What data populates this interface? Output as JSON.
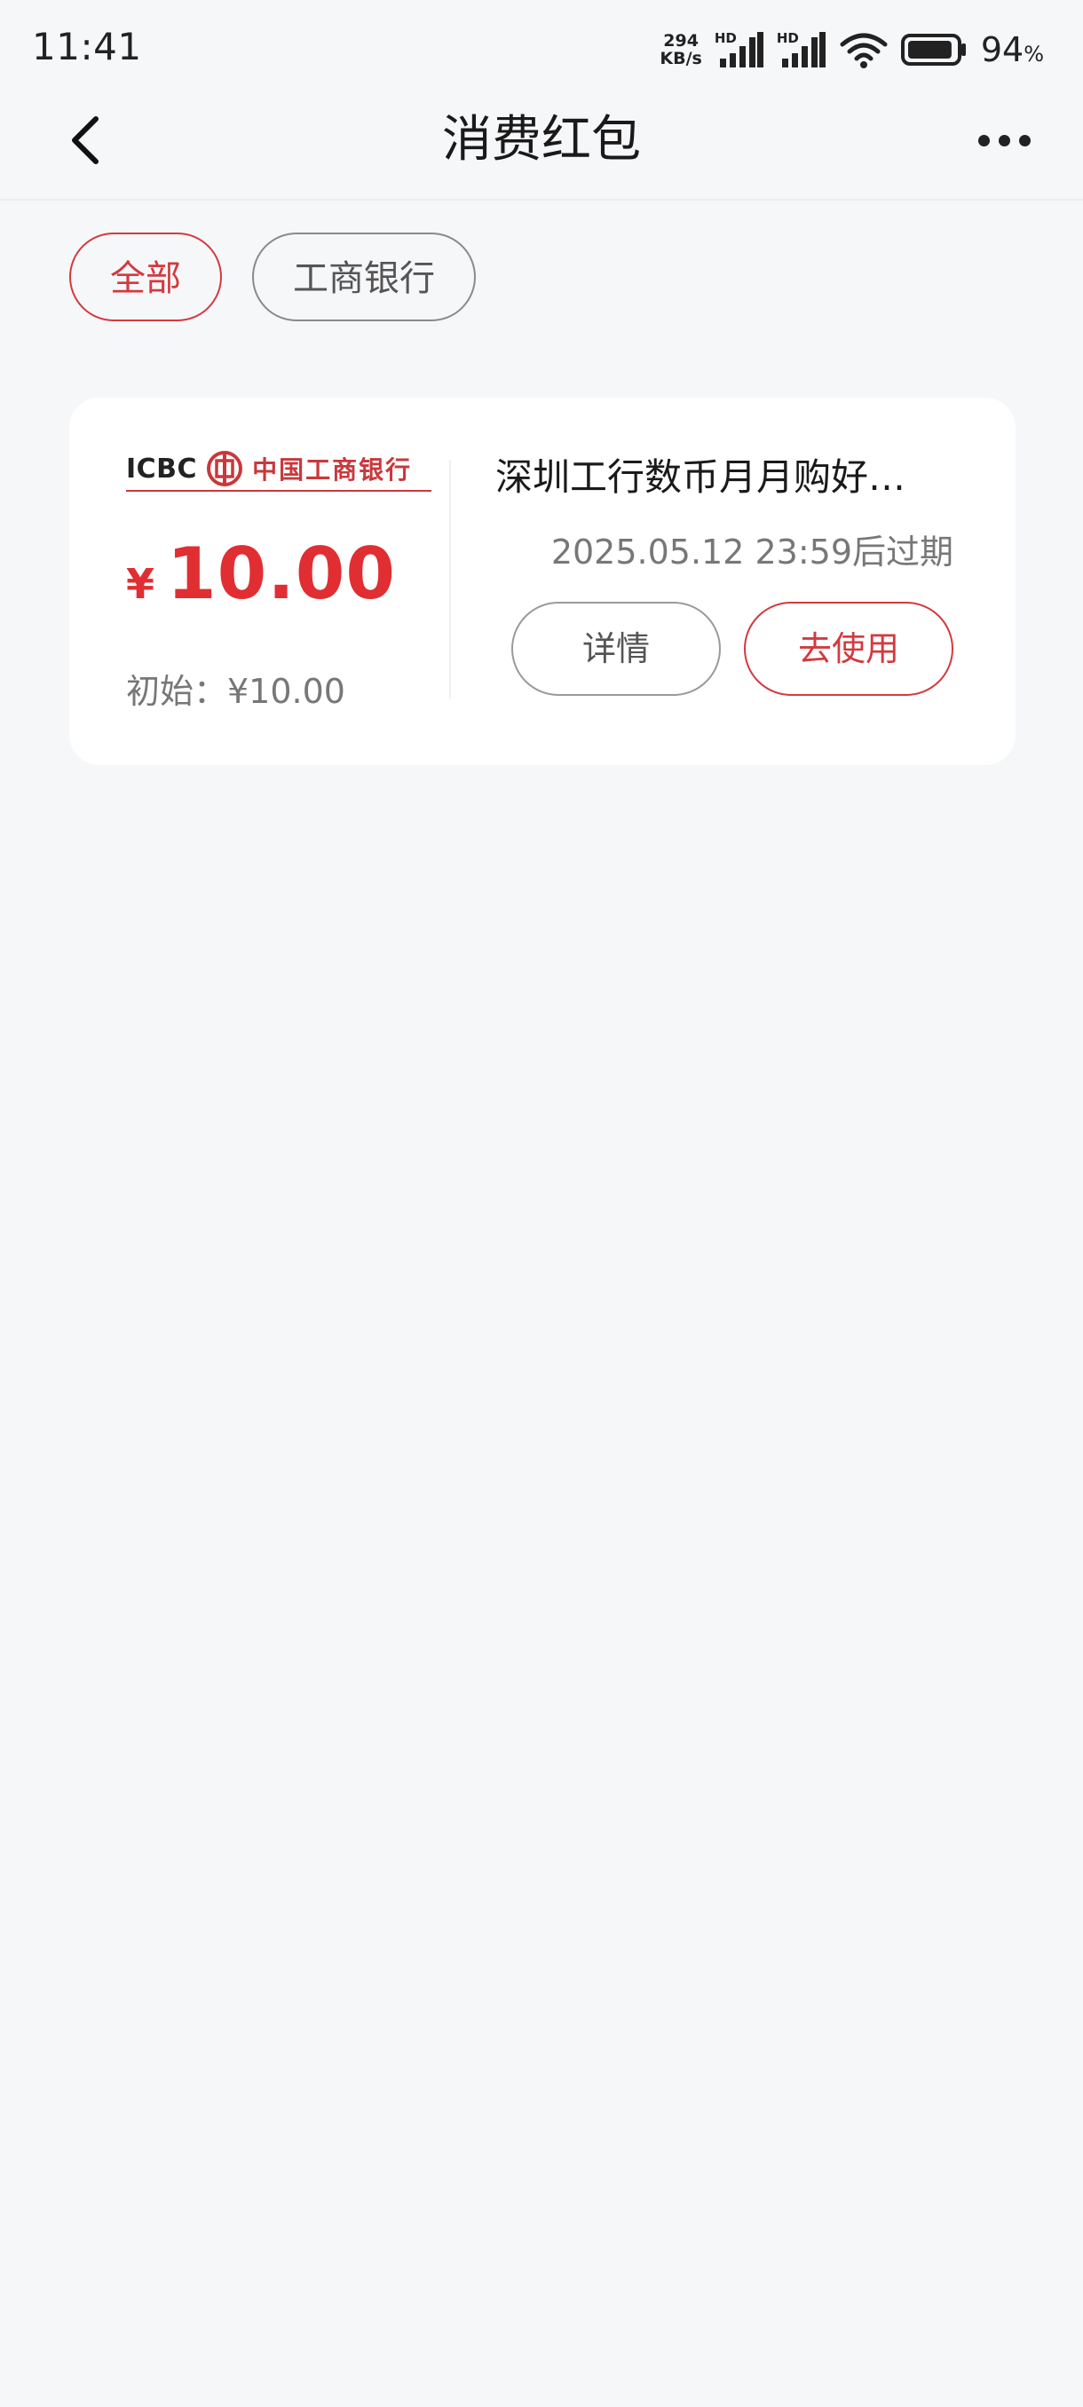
{
  "status_bar": {
    "time": "11:41",
    "net_speed_value": "294",
    "net_speed_unit": "KB/s",
    "sim1_label": "HD",
    "sim2_label": "HD",
    "battery_value": "94",
    "battery_unit": "%",
    "battery_level": 0.94
  },
  "nav": {
    "title": "消费红包"
  },
  "filters": [
    {
      "label": "全部",
      "active": true
    },
    {
      "label": "工商银行",
      "active": false
    }
  ],
  "coupon": {
    "logo_en": "ICBC",
    "logo_cn": "中国工商银行",
    "currency": "¥",
    "amount": "10.00",
    "initial_text": "初始：¥10.00",
    "name": "深圳工行数币月月购好…",
    "expiry": "2025.05.12 23:59后过期",
    "detail_label": "详情",
    "use_label": "去使用"
  },
  "colors": {
    "accent": "#d23a3f",
    "amount": "#e02e32",
    "background": "#f6f7f9"
  }
}
